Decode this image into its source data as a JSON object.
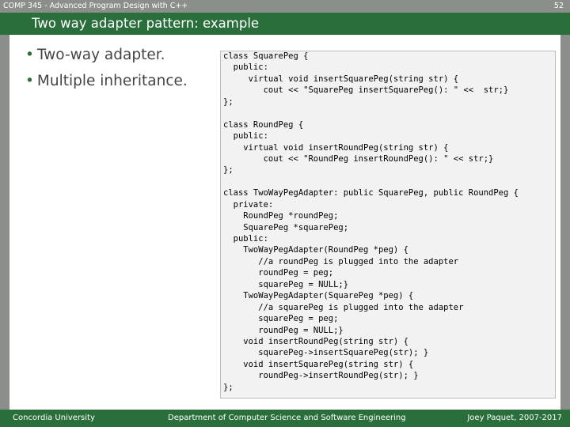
{
  "header": {
    "course": "COMP 345 - Advanced Program Design with C++",
    "page": "52"
  },
  "title": "Two way adapter pattern: example",
  "bullets": [
    "Two-way adapter.",
    "Multiple inheritance."
  ],
  "code_lines": [
    "class SquarePeg {",
    "  public:",
    "     virtual void insertSquarePeg(string str) {",
    "        cout << \"SquarePeg insertSquarePeg(): \" <<  str;}",
    "};",
    "",
    "class RoundPeg {",
    "  public:",
    "    virtual void insertRoundPeg(string str) {",
    "        cout << \"RoundPeg insertRoundPeg(): \" << str;}",
    "};",
    "",
    "class TwoWayPegAdapter: public SquarePeg, public RoundPeg {",
    "  private:",
    "    RoundPeg *roundPeg;",
    "    SquarePeg *squarePeg;",
    "  public:",
    "    TwoWayPegAdapter(RoundPeg *peg) {",
    "       //a roundPeg is plugged into the adapter",
    "       roundPeg = peg;",
    "       squarePeg = NULL;}",
    "    TwoWayPegAdapter(SquarePeg *peg) {",
    "       //a squarePeg is plugged into the adapter",
    "       squarePeg = peg;",
    "       roundPeg = NULL;}",
    "    void insertRoundPeg(string str) {",
    "       squarePeg->insertSquarePeg(str); }",
    "    void insertSquarePeg(string str) {",
    "       roundPeg->insertRoundPeg(str); }",
    "};"
  ],
  "footer": {
    "left": "Concordia University",
    "center": "Department of Computer Science and Software Engineering",
    "right": "Joey Paquet, 2007-2017"
  },
  "colors": {
    "accent": "#2a6e3b",
    "bar": "#8a8f89",
    "code_bg": "#f2f2f2"
  }
}
